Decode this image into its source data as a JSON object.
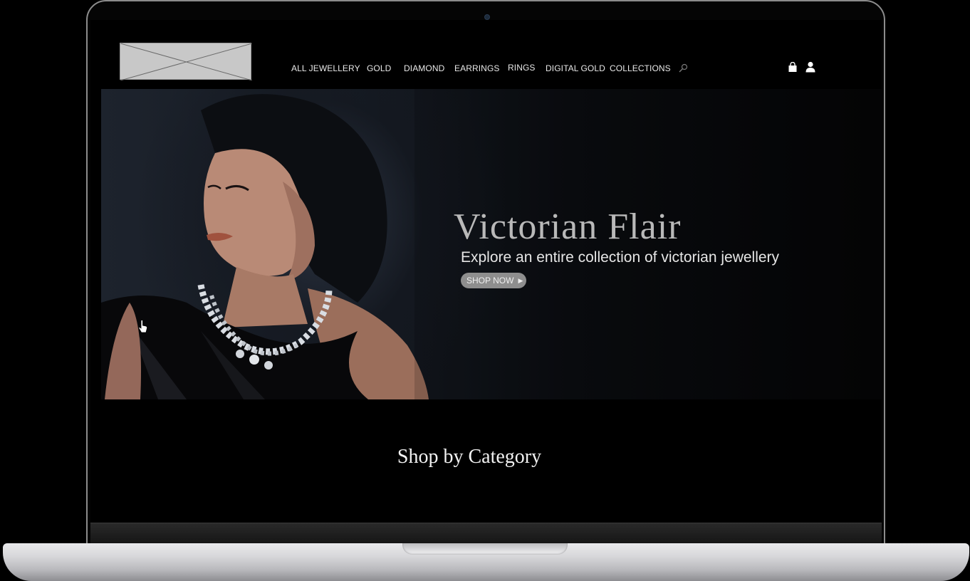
{
  "nav": {
    "items": [
      {
        "label": "ALL JEWELLERY"
      },
      {
        "label": "GOLD"
      },
      {
        "label": "DIAMOND"
      },
      {
        "label": "EARRINGS"
      },
      {
        "label": "RINGS"
      },
      {
        "label": "DIGITAL GOLD"
      },
      {
        "label": "COLLECTIONS"
      }
    ],
    "icons": [
      "search-icon",
      "shopping-bag-icon",
      "user-icon"
    ]
  },
  "hero": {
    "title": "Victorian Flair",
    "subtitle": "Explore an entire collection of victorian jewellery",
    "cta_label": "SHOP NOW"
  },
  "sections": {
    "category_title": "Shop by Category"
  },
  "colors": {
    "background": "#000000",
    "nav_text": "#e8e8e8",
    "hero_title": "#b9b9b9",
    "cta_bg": "#8e8e8e"
  }
}
